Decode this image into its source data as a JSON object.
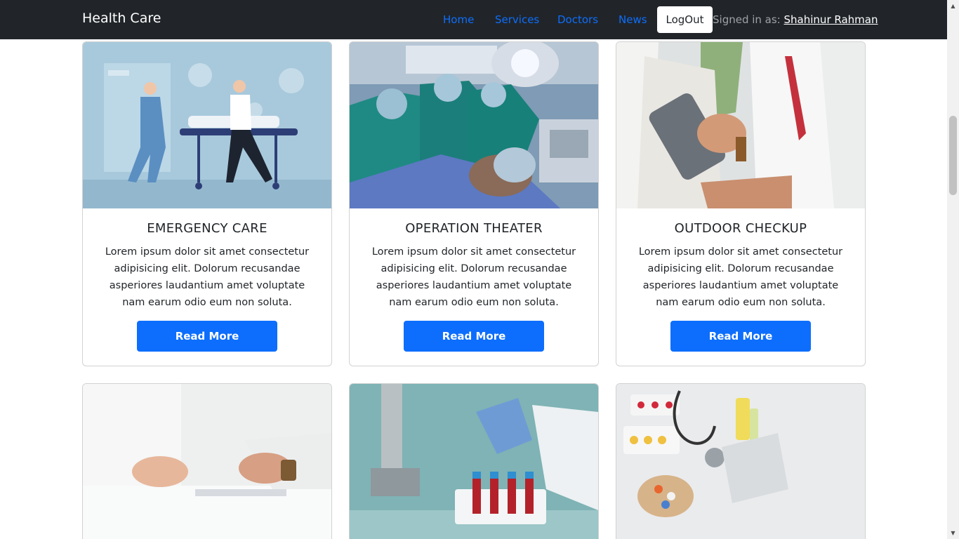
{
  "navbar": {
    "brand": "Health Care",
    "links": [
      "Home",
      "Services",
      "Doctors",
      "News"
    ],
    "logout_label": "LogOut",
    "signed_in_prefix": "Signed in as:",
    "user_name": "Shahinur Rahman"
  },
  "colors": {
    "navbar_bg": "#212529",
    "link": "#0d6efd",
    "button": "#0d6efd"
  },
  "cards": [
    {
      "title": "EMERGENCY CARE",
      "text": "Lorem ipsum dolor sit amet consectetur adipisicing elit. Dolorum recusandae asperiores laudantium amet voluptate nam earum odio eum non soluta.",
      "button": "Read More",
      "image": "emergency-illustration"
    },
    {
      "title": "OPERATION THEATER",
      "text": "Lorem ipsum dolor sit amet consectetur adipisicing elit. Dolorum recusandae asperiores laudantium amet voluptate nam earum odio eum non soluta.",
      "button": "Read More",
      "image": "surgery-photo"
    },
    {
      "title": "OUTDOOR CHECKUP",
      "text": "Lorem ipsum dolor sit amet consectetur adipisicing elit. Dolorum recusandae asperiores laudantium amet voluptate nam earum odio eum non soluta.",
      "button": "Read More",
      "image": "blood-pressure-photo"
    },
    {
      "image": "consultation-photo"
    },
    {
      "image": "lab-test-tubes-photo"
    },
    {
      "image": "medicine-stethoscope-photo"
    }
  ]
}
